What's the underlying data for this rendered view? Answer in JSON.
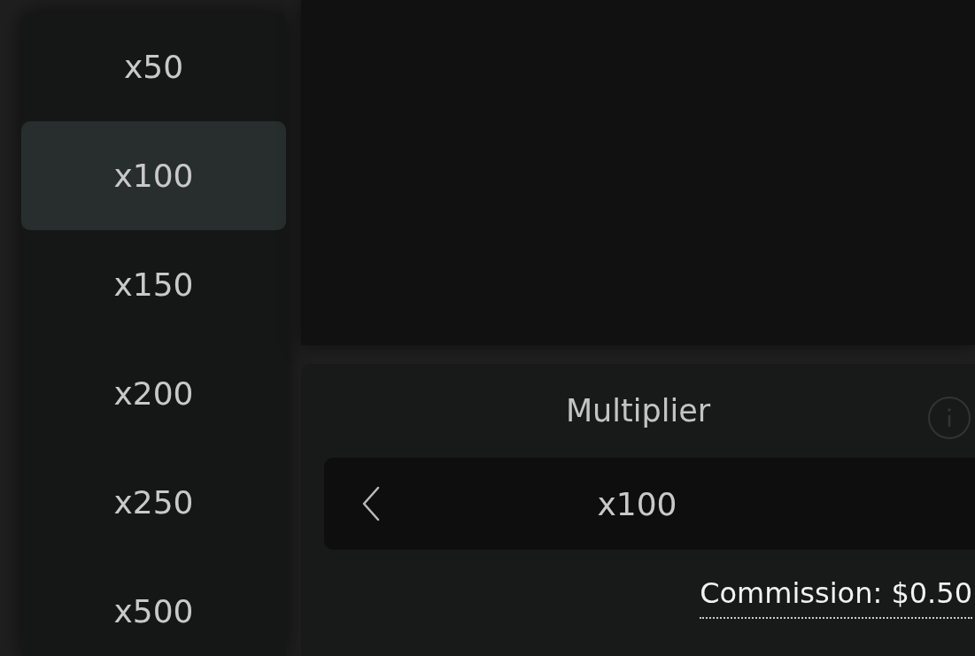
{
  "multiplier_options": [
    {
      "label": "x50",
      "selected": false
    },
    {
      "label": "x100",
      "selected": true
    },
    {
      "label": "x150",
      "selected": false
    },
    {
      "label": "x200",
      "selected": false
    },
    {
      "label": "x250",
      "selected": false
    },
    {
      "label": "x500",
      "selected": false
    }
  ],
  "multiplier_panel": {
    "title": "Multiplier",
    "value": "x100",
    "commission": "Commission: $0.50"
  }
}
